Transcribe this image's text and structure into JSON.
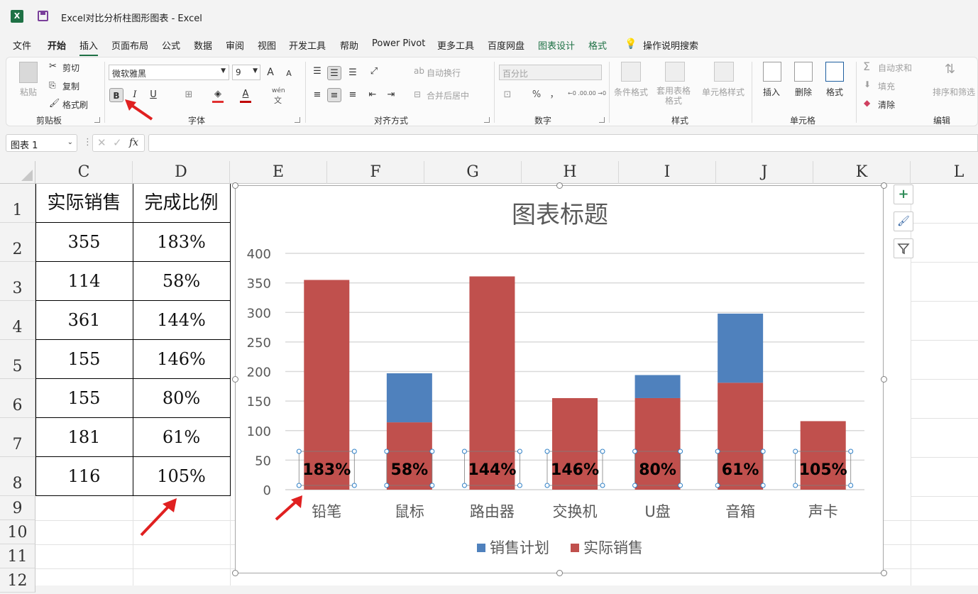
{
  "window": {
    "title": "Excel对比分析柱图形图表  -  Excel",
    "logo": "X"
  },
  "menu": [
    "文件",
    "开始",
    "插入",
    "页面布局",
    "公式",
    "数据",
    "审阅",
    "视图",
    "开发工具",
    "帮助",
    "Power Pivot",
    "更多工具",
    "百度网盘",
    "图表设计",
    "格式",
    "操作说明搜索"
  ],
  "ribbon": {
    "clipboard": {
      "paste": "粘贴",
      "cut": "剪切",
      "copy": "复制",
      "format_painter": "格式刷",
      "group": "剪贴板"
    },
    "font": {
      "name": "微软雅黑",
      "size": "9",
      "bold": "B",
      "italic": "I",
      "underline": "U",
      "grow": "A",
      "shrink": "A",
      "group": "字体",
      "wen": "wén",
      "wen2": "文"
    },
    "alignment": {
      "wrap": "自动换行",
      "merge": "合并后居中",
      "group": "对齐方式"
    },
    "number": {
      "format": "百分比",
      "percent": "%",
      "comma": "，",
      "dec_inc": "←0 .00",
      "dec_dec": ".00 →0",
      "group": "数字"
    },
    "styles": {
      "cond": "条件格式",
      "table_fmt": "套用表格格式",
      "cell_style": "单元格样式",
      "group": "样式"
    },
    "cells": {
      "insert": "插入",
      "delete": "删除",
      "format": "格式",
      "group": "单元格"
    },
    "editing": {
      "autosum": "自动求和",
      "fill": "填充",
      "clear": "清除",
      "sort": "排序和筛选",
      "group": "编辑"
    }
  },
  "formula_bar": {
    "name_box": "图表 1",
    "fx": "fx",
    "value": ""
  },
  "columns": [
    "C",
    "D",
    "E",
    "F",
    "G",
    "H",
    "I",
    "J",
    "K",
    "L"
  ],
  "rows": [
    "1",
    "2",
    "3",
    "4",
    "5",
    "6",
    "7",
    "8",
    "9",
    "10",
    "11",
    "12"
  ],
  "table": {
    "headers": [
      "实际销售",
      "完成比例"
    ],
    "rows": [
      [
        "355",
        "183%"
      ],
      [
        "114",
        "58%"
      ],
      [
        "361",
        "144%"
      ],
      [
        "155",
        "146%"
      ],
      [
        "155",
        "80%"
      ],
      [
        "181",
        "61%"
      ],
      [
        "116",
        "105%"
      ]
    ]
  },
  "chart_data": {
    "type": "bar",
    "stacked": true,
    "title": "图表标题",
    "categories": [
      "铅笔",
      "鼠标",
      "路由器",
      "交换机",
      "U盘",
      "音箱",
      "声卡"
    ],
    "series": [
      {
        "name": "实际销售",
        "color": "#c0504d",
        "values": [
          355,
          114,
          361,
          155,
          155,
          181,
          116
        ]
      },
      {
        "name": "销售计划",
        "color": "#4f81bd",
        "values": [
          0,
          83,
          0,
          0,
          39,
          117,
          0
        ]
      }
    ],
    "data_labels": [
      "183%",
      "58%",
      "144%",
      "146%",
      "80%",
      "61%",
      "105%"
    ],
    "yticks": [
      "0",
      "50",
      "100",
      "150",
      "200",
      "250",
      "300",
      "350",
      "400"
    ],
    "ylim": [
      0,
      400
    ],
    "grid": true,
    "legend_position": "bottom",
    "legend": [
      "销售计划",
      "实际销售"
    ]
  }
}
